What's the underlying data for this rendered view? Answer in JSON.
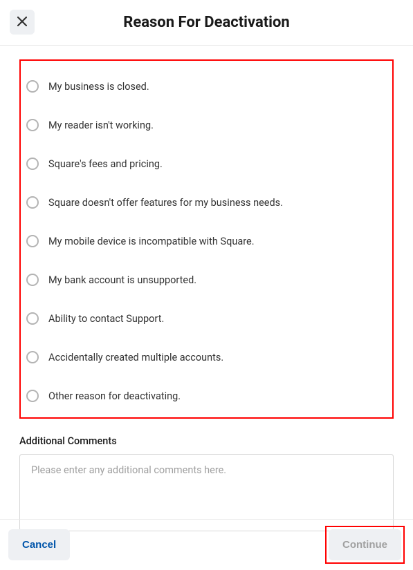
{
  "header": {
    "title": "Reason For Deactivation"
  },
  "reasons": [
    {
      "label": "My business is closed."
    },
    {
      "label": "My reader isn't working."
    },
    {
      "label": "Square's fees and pricing."
    },
    {
      "label": "Square doesn't offer features for my business needs."
    },
    {
      "label": "My mobile device is incompatible with Square."
    },
    {
      "label": "My bank account is unsupported."
    },
    {
      "label": "Ability to contact Support."
    },
    {
      "label": "Accidentally created multiple accounts."
    },
    {
      "label": "Other reason for deactivating."
    }
  ],
  "comments": {
    "label": "Additional Comments",
    "placeholder": "Please enter any additional comments here."
  },
  "footer": {
    "cancel": "Cancel",
    "continue": "Continue"
  }
}
